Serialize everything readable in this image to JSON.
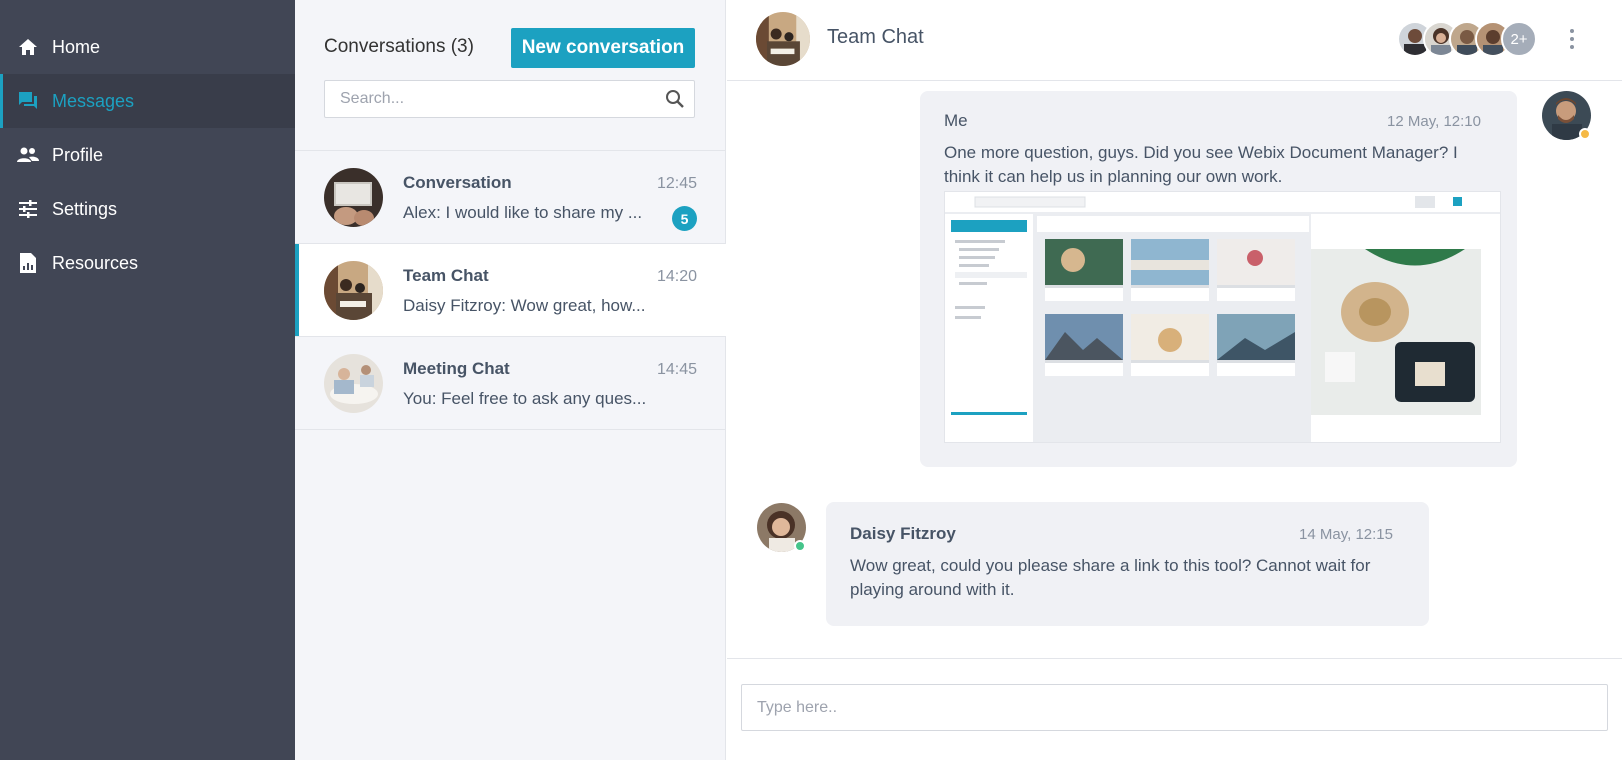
{
  "sidebar": {
    "items": [
      {
        "label": "Home",
        "icon": "home-icon"
      },
      {
        "label": "Messages",
        "icon": "chat-icon",
        "active": true
      },
      {
        "label": "Profile",
        "icon": "people-icon"
      },
      {
        "label": "Settings",
        "icon": "sliders-icon"
      },
      {
        "label": "Resources",
        "icon": "document-chart-icon"
      }
    ]
  },
  "conversations": {
    "title": "Conversations (3)",
    "new_button": "New conversation",
    "search_placeholder": "Search...",
    "items": [
      {
        "name": "Conversation",
        "time": "12:45",
        "preview": "Alex: I would like to share my ...",
        "badge": "5"
      },
      {
        "name": "Team Chat",
        "time": "14:20",
        "preview": "Daisy Fitzroy: Wow great, how...",
        "active": true
      },
      {
        "name": "Meeting Chat",
        "time": "14:45",
        "preview": "You: Feel free to ask any ques..."
      }
    ]
  },
  "chat": {
    "title": "Team Chat",
    "more_members": "2+",
    "composer_placeholder": "Type here..",
    "messages": [
      {
        "author": "Me",
        "time": "12 May, 12:10",
        "text": "One more question, guys. Did you see Webix Document Manager? I think it can help us in planning our own work."
      },
      {
        "author": "Daisy Fitzroy",
        "time": "14 May, 12:15",
        "text": "Wow great, could you please share a link to this tool? Cannot wait for playing around with it."
      }
    ]
  },
  "colors": {
    "accent": "#1ca1c1",
    "sidebar_bg": "#414655",
    "online": "#45c48a",
    "away": "#f5b945"
  }
}
